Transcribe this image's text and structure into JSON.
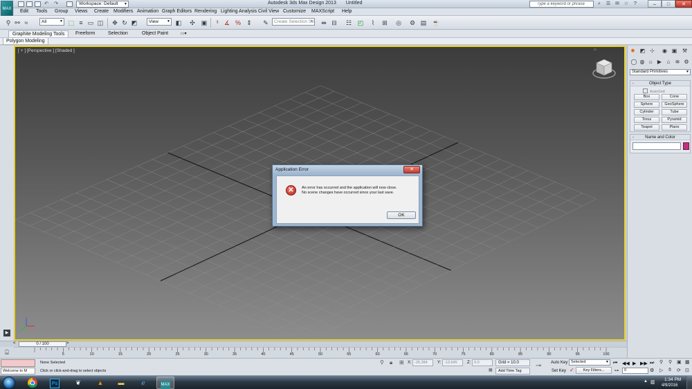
{
  "window": {
    "title": "Autodesk 3ds Max Design 2013",
    "document": "Untitled",
    "workspace": "Workspace: Default",
    "search_placeholder": "Type a keyword or phrase",
    "minimize": "–",
    "maximize": "□",
    "close": "✕"
  },
  "menus": [
    "Edit",
    "Tools",
    "Group",
    "Views",
    "Create",
    "Modifiers",
    "Animation",
    "Graph Editors",
    "Rendering",
    "Lighting Analysis",
    "Civil View",
    "Customize",
    "MAXScript",
    "Help"
  ],
  "toolbar": {
    "selection_filter": "All",
    "reference_coord": "View",
    "named_selection_placeholder": "Create Selection Se"
  },
  "ribbon": {
    "tabs": [
      "Graphite Modeling Tools",
      "Freeform",
      "Selection",
      "Object Paint"
    ],
    "panel": "Polygon Modeling"
  },
  "viewport": {
    "label": "[ + ] [Perspective ] [Shaded ]"
  },
  "dialog": {
    "title": "Application Error",
    "close": "✕",
    "message_line1": "An error has occurred and the application will now close.",
    "message_line2": "No scene changes have occurred since your last save.",
    "ok": "OK"
  },
  "command_panel": {
    "dropdown": "Standard Primitives",
    "object_type": {
      "header": "Object Type",
      "autogrid": "AutoGrid",
      "buttons": [
        "Box",
        "Cone",
        "Sphere",
        "GeoSphere",
        "Cylinder",
        "Tube",
        "Torus",
        "Pyramid",
        "Teapot",
        "Plane"
      ]
    },
    "name_and_color": {
      "header": "Name and Color",
      "color": "#c3307d"
    }
  },
  "timeline": {
    "frame": "0 / 100",
    "prev": "<",
    "next": ">",
    "ticks": [
      "5",
      "10",
      "15",
      "20",
      "25",
      "30",
      "35",
      "40",
      "45",
      "50",
      "55",
      "60",
      "65",
      "70",
      "75",
      "80",
      "85",
      "90",
      "95",
      "100"
    ]
  },
  "status": {
    "maxscript_text": "Welcome to M",
    "selection": "None Selected",
    "prompt": "Click or click-and-drag to select objects",
    "x_label": "X:",
    "x_value": "-26.284",
    "y_label": "Y:",
    "y_value": "-13.645",
    "z_label": "Z:",
    "z_value": "0.0",
    "grid": "Grid = 10.0",
    "add_time_tag": "Add Time Tag",
    "auto_key": "Auto Key",
    "set_key": "Set Key",
    "selected": "Selected",
    "key_filters": "Key Filters...",
    "current_frame": "0"
  },
  "taskbar": {
    "time": "1:34 PM",
    "date": "4/9/2016"
  }
}
